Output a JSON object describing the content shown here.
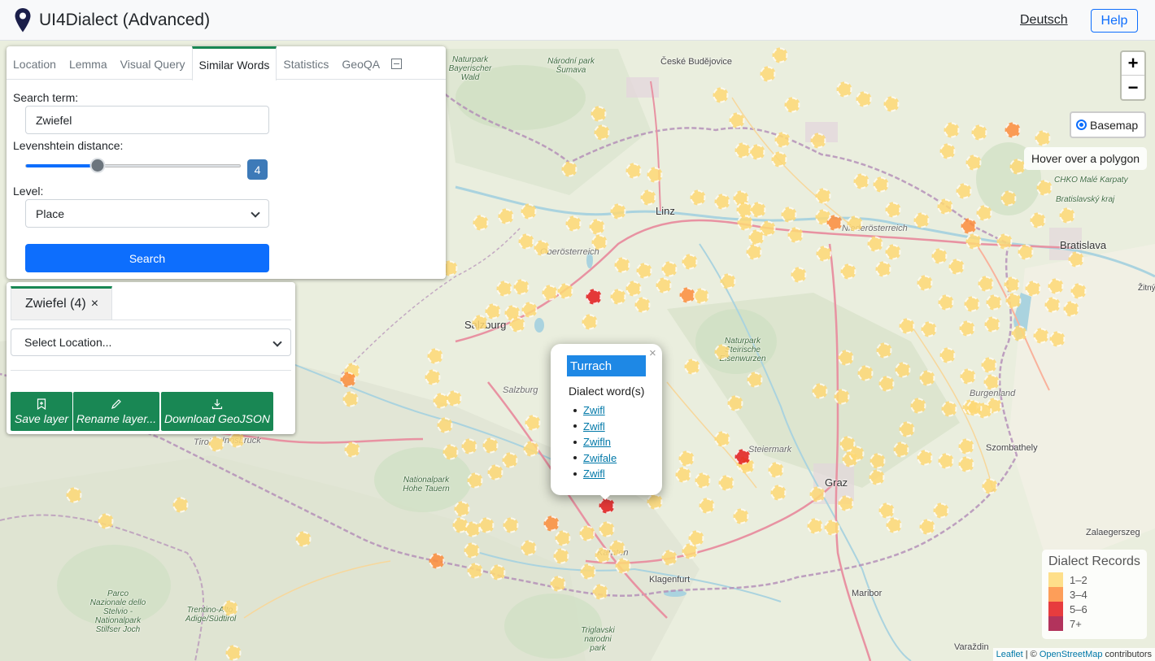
{
  "header": {
    "title": "UI4Dialect (Advanced)",
    "language_link": "Deutsch",
    "help_label": "Help"
  },
  "tabs": [
    {
      "label": "Location",
      "active": false
    },
    {
      "label": "Lemma",
      "active": false
    },
    {
      "label": "Visual Query",
      "active": false
    },
    {
      "label": "Similar Words",
      "active": true
    },
    {
      "label": "Statistics",
      "active": false
    },
    {
      "label": "GeoQA",
      "active": false
    }
  ],
  "similar_words": {
    "search_label": "Search term:",
    "search_value": "Zwiefel",
    "distance_label": "Levenshtein distance:",
    "distance_value": "4",
    "distance_max": 12,
    "level_label": "Level:",
    "level_value": "Place",
    "search_button": "Search"
  },
  "layer_panel": {
    "tab_label": "Zwiefel (4)",
    "close_symbol": "×",
    "location_select": "Select Location...",
    "save_label": "Save layer",
    "rename_label": "Rename layer...",
    "download_label": "Download GeoJSON"
  },
  "map": {
    "zoom_in": "+",
    "zoom_out": "−",
    "basemap_label": "Basemap",
    "hover_info": "Hover over a polygon",
    "labels": {
      "linz": "Linz",
      "salzburg": "Salzburg",
      "graz": "Graz",
      "klagenfurt": "Klagenfurt",
      "bratislava": "Bratislava",
      "ceske_budejovice": "České Budějovice",
      "szombathely": "Szombathely",
      "zalaegerszeg": "Zalaegerszeg",
      "maribor": "Maribor",
      "varazdin": "Varaždin",
      "zitny": "Žitný",
      "oberoesterreich": "Oberösterreich",
      "niederoesterreich": "Niederösterreich",
      "steiermark": "Steiermark",
      "burgenland": "Burgenland",
      "kaernten": "Kärnten",
      "tirol": "Tirol",
      "innsbruck": "Innsbruck",
      "salzburg_region": "Salzburg",
      "bratislavsky": "Bratislavský kraj",
      "male_karpaty": "CHKO Malé Karpaty",
      "np_sumava": "Národní park Šumava",
      "np_bayerischer": "Naturpark Bayerischer Wald",
      "np_hohe_tauern": "Nationalpark Hohe Tauern",
      "np_eisenwurzen": "Naturpark Steirische Eisenwurzen",
      "stelvio": "Parco Nazionale dello Stelvio - Nationalpark Stilfser Joch",
      "trentino": "Trentino-Alto Adige/Südtirol",
      "triglavski": "Triglavski narodni park"
    }
  },
  "legend": {
    "title": "Dialect Records",
    "items": [
      {
        "label": "1–2",
        "color": "#fed976"
      },
      {
        "label": "3–4",
        "color": "#fd8d3c"
      },
      {
        "label": "5–6",
        "color": "#e31a1c"
      },
      {
        "label": "7+",
        "color": "#a50f40"
      }
    ]
  },
  "popup": {
    "title": "Turrach",
    "subtitle": "Dialect word(s)",
    "words": [
      "Zwifl",
      "Zwifl",
      "Zwifln",
      "Zwifale",
      "Zwifl"
    ],
    "close": "×"
  },
  "attribution": {
    "leaflet": "Leaflet",
    "separator": " | © ",
    "osm": "OpenStreetMap",
    "suffix": " contributors"
  },
  "colors": {
    "accent": "#0d6efd",
    "tab_active": "#198754",
    "marker_low": "#fed976",
    "marker_mid": "#fd8d3c",
    "marker_high": "#e31a1c"
  }
}
